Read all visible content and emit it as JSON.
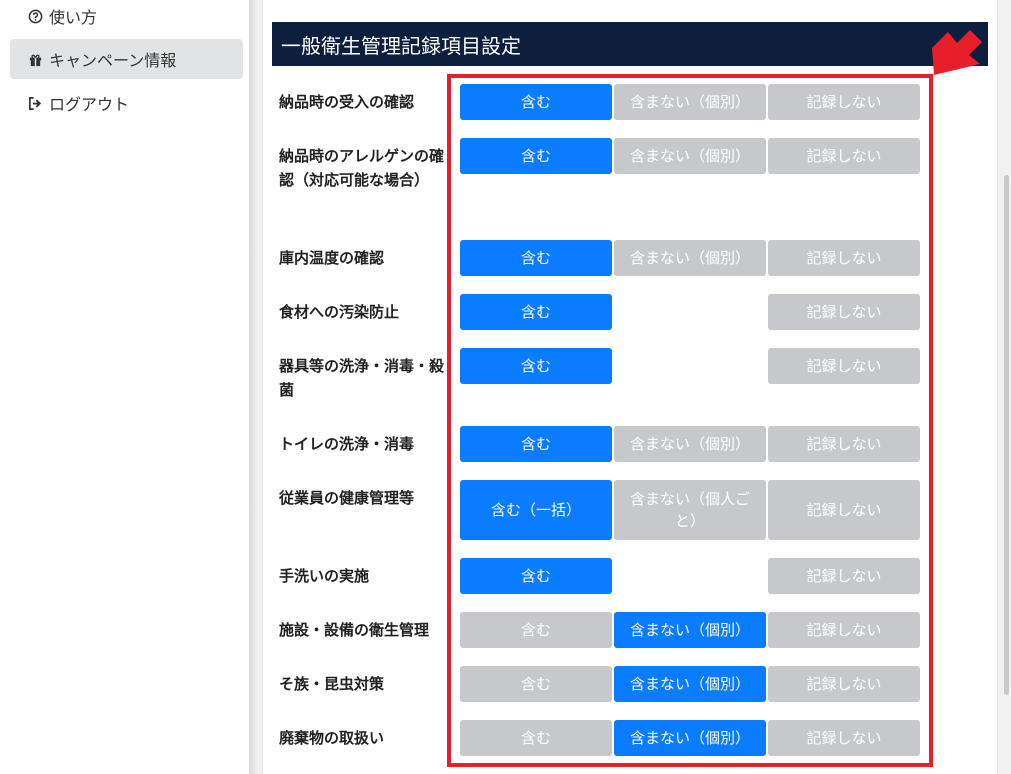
{
  "sidebar": {
    "items": [
      {
        "label": "使い方",
        "icon": "question-circle-icon"
      },
      {
        "label": "キャンペーン情報",
        "icon": "gift-icon"
      },
      {
        "label": "ログアウト",
        "icon": "logout-icon"
      }
    ]
  },
  "section": {
    "title": "一般衛生管理記録項目設定"
  },
  "rows": [
    {
      "label": "納品時の受入の確認",
      "options": [
        "含む",
        "含まない（個別）",
        "記録しない"
      ],
      "selected": 0
    },
    {
      "label": "納品時のアレルゲンの確認（対応可能な場合）",
      "options": [
        "含む",
        "含まない（個別）",
        "記録しない"
      ],
      "selected": 0
    },
    {
      "label": "庫内温度の確認",
      "options": [
        "含む",
        "含まない（個別）",
        "記録しない"
      ],
      "selected": 0
    },
    {
      "label": "食材への汚染防止",
      "options": [
        "含む",
        "記録しない"
      ],
      "selected": 0
    },
    {
      "label": "器具等の洗浄・消毒・殺菌",
      "options": [
        "含む",
        "記録しない"
      ],
      "selected": 0
    },
    {
      "label": "トイレの洗浄・消毒",
      "options": [
        "含む",
        "含まない（個別）",
        "記録しない"
      ],
      "selected": 0
    },
    {
      "label": "従業員の健康管理等",
      "options": [
        "含む（一括）",
        "含まない（個人ごと）",
        "記録しない"
      ],
      "selected": 0
    },
    {
      "label": "手洗いの実施",
      "options": [
        "含む",
        "記録しない"
      ],
      "selected": 0
    },
    {
      "label": "施設・設備の衛生管理",
      "options": [
        "含む",
        "含まない（個別）",
        "記録しない"
      ],
      "selected": 1
    },
    {
      "label": "そ族・昆虫対策",
      "options": [
        "含む",
        "含まない（個別）",
        "記録しない"
      ],
      "selected": 1
    },
    {
      "label": "廃棄物の取扱い",
      "options": [
        "含む",
        "含まない（個別）",
        "記録しない"
      ],
      "selected": 1
    }
  ],
  "colors": {
    "header_bg": "#0d1f3c",
    "selected": "#0a7cff",
    "unselected": "#c6c8cb",
    "highlight": "#e81f2b"
  }
}
